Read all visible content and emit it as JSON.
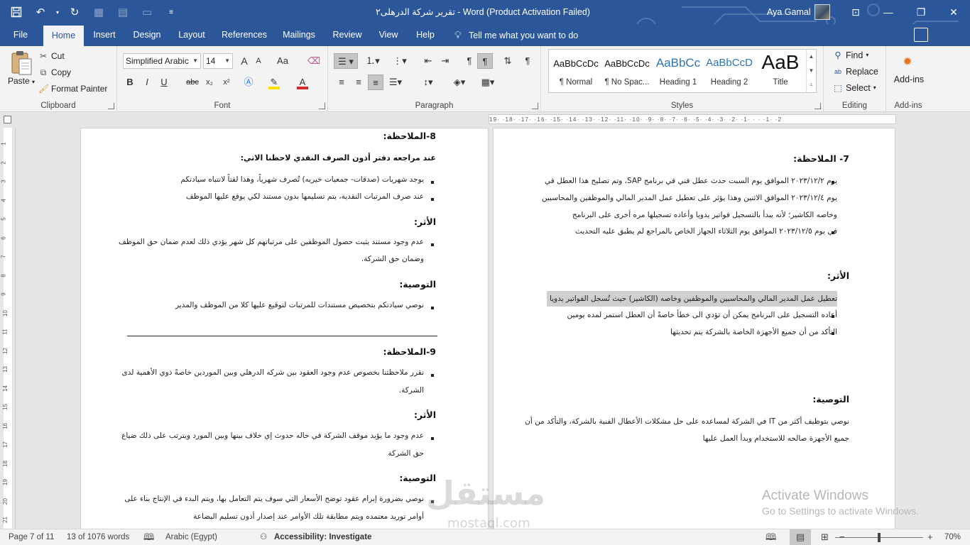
{
  "titlebar": {
    "title": "تقرير شركة الدرهلى٢  -  Word (Product Activation Failed)",
    "user": "Aya Gamal",
    "minimize": "—",
    "restore": "❐",
    "close": "✕",
    "ribbon_display": "⊡"
  },
  "tabs": [
    "File",
    "Home",
    "Insert",
    "Design",
    "Layout",
    "References",
    "Mailings",
    "Review",
    "View",
    "Help"
  ],
  "tellme": "Tell me what you want to do",
  "clipboard": {
    "paste": "Paste",
    "cut": "Cut",
    "copy": "Copy",
    "format_painter": "Format Painter",
    "label": "Clipboard"
  },
  "font": {
    "name": "Simplified Arabic",
    "size": "14",
    "label": "Font",
    "grow": "A",
    "shrink": "A",
    "case": "Aa",
    "bold": "B",
    "italic": "I",
    "underline": "U",
    "strike": "abc",
    "subscript": "x₂",
    "superscript": "x²",
    "font_color": "A"
  },
  "paragraph": {
    "label": "Paragraph"
  },
  "styles": {
    "label": "Styles",
    "items": [
      {
        "preview": "AaBbCcDc",
        "name": "¶ Normal"
      },
      {
        "preview": "AaBbCcDc",
        "name": "¶ No Spac..."
      },
      {
        "preview": "AaBbCc",
        "name": "Heading 1"
      },
      {
        "preview": "AaBbCcD",
        "name": "Heading 2"
      },
      {
        "preview": "AaB",
        "name": "Title"
      }
    ]
  },
  "editing": {
    "label": "Editing",
    "find": "Find",
    "replace": "Replace",
    "select": "Select"
  },
  "addins": {
    "button": "Add-ins",
    "label": "Add-ins"
  },
  "ruler": {
    "horizontal": "19· ·18· ·17· ·16· ·15· ·14· ·13· ·12· ·11· ·10· ·9· ·8· ·7· ·6· ·5· ·4· ·3· ·2· ·1· · · ·1· ·2",
    "vertical": [
      "1",
      "2",
      "3",
      "4",
      "5",
      "6",
      "7",
      "8",
      "9",
      "10",
      "11",
      "12",
      "13",
      "14",
      "15",
      "16",
      "17",
      "18",
      "19",
      "20",
      "21"
    ]
  },
  "left_page": {
    "h1": "8-الملاحظة:",
    "sub1": "عند مراجعه دفتر أذون الصرف النقدي لاحظنا الاتي:",
    "b1": "يوجد شهريات (صدقات- جمعيات خيريه) تُصرف شهرياً، وهذا لفتاً لانتباه سيادتكم",
    "b2": "عند صرف المرتبات النقدية، يتم تسليمها بدون مستند لكي يوقع عليها الموظف",
    "h2": "الأثر:",
    "b3_l1": "عدم وجود مستند يثبت حصول الموظفين على مرتباتهم كل شهر يؤدي ذلك لعدم ضمان حق الموظف",
    "b3_l2": "وضمان حق الشركة.",
    "h3": "التوصية:",
    "b4": "نوصي سيادتكم بتخصيص مستندات للمرتبات لتوقيع عليها كلا من الموظف والمدير",
    "h4": "9-الملاحظة:",
    "b5_l1": "نقرر ملاحظتنا بخصوص عدم وجود العقود بين شركه الدرهلي وبين الموردين خاصةً ذوي الأهمية لدى",
    "b5_l2": "الشركة.",
    "h5": "الأثر:",
    "b6_l1": "عدم وجود ما يؤيد موقف الشركة في حاله حدوث إي خلاف بينها وبين المورد ويترتب على ذلك ضياع",
    "b6_l2": "حق الشركة",
    "h6": "التوصية:",
    "b7_l1": "نوصي بضرورة إبرام عقود توضح الأسعار التي سوف يتم التعامل بها، ويتم البدء في الإنتاج بناء على",
    "b7_l2": "أوامر توريد معتمده ويتم مطابقة تلك الأوامر عند إصدار أذون تسليم البضاعة"
  },
  "right_page": {
    "h1": "7- الملاحظة:",
    "b1_l1": "يوم ٢٠٢٣/١٢/٢ الموافق يوم السبت حدث عطل فني في برنامج SAP، وتم تصليح هذا العطل في",
    "b1_l2": "يوم ٢٠٢٣/١٢/٤ الموافق الاثنين وهذا يؤثر على تعطيل عمل المدير المالي والموظفين والمحاسبين",
    "b1_l3": "وخاصه الكاشير؛ لأنه يبدأ بالتسجيل فواتير يدويا وأعاده تسجيلها مره أخرى على البرنامج",
    "b2": "في يوم ٢٠٢٣/١٢/٥ الموافق يوم الثلاثاء الجهاز الخاص بالمراجع لم يطبق عليه التحديث",
    "h2": "الأثر:",
    "b3": "تعطيل عمل المدير المالي والمحاسبين والموظفين وخاصه (الكاشير) حيث تُسجل الفواتير يدويا",
    "b4": "أعاده التسجيل على البرنامج يمكن أن تؤدي الى خطأ خاصةً أن العطل استمر لمده يومين",
    "b5": "التأكد من أن جميع الأجهزة الخاصة بالشركة يتم تحديثها",
    "h3": "التوصية:",
    "p1_l1": "نوصي بتوظيف أكثر من IT في الشركة لمساعده على حل مشكلات الأعطال الفنية بالشركة، والتأكد من أن",
    "p1_l2": "جميع الأجهزة صالحه للاستخدام وبدأ العمل عليها"
  },
  "activation": {
    "line1": "Activate Windows",
    "line2": "Go to Settings to activate Windows."
  },
  "watermark": {
    "logo": "مستقل",
    "site": "mostaql.com"
  },
  "statusbar": {
    "page": "Page 7 of 11",
    "words": "13 of 1076 words",
    "language": "Arabic (Egypt)",
    "accessibility": "Accessibility: Investigate",
    "zoom": "70%",
    "zoom_out": "−",
    "zoom_in": "+"
  },
  "colors": {
    "brand": "#2b579a",
    "highlight": "#cfcfcf",
    "font_color_bar": "#d62b2b",
    "highlight_bar": "#ffe400"
  }
}
